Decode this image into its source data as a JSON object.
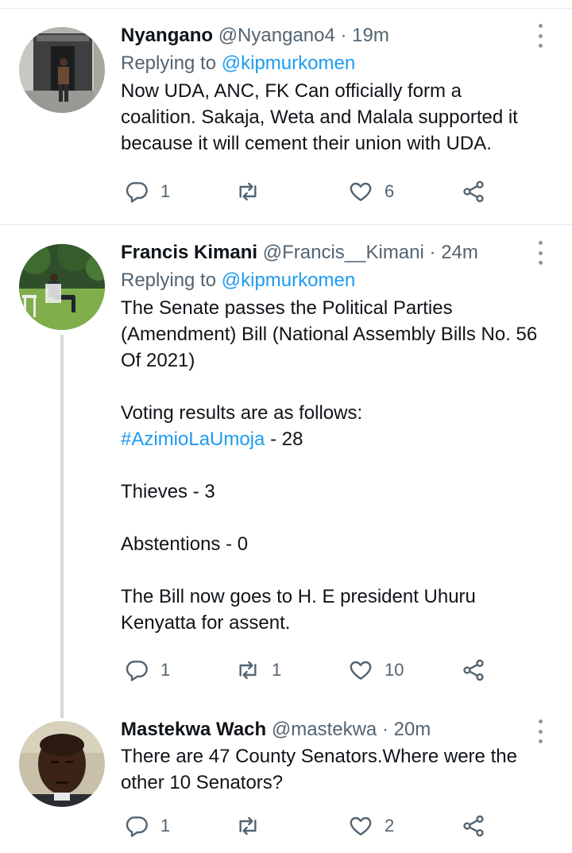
{
  "tweets": [
    {
      "name": "Nyangano",
      "handle": "@Nyangano4",
      "separator": "·",
      "time": "19m",
      "replying_prefix": "Replying to",
      "replying_to": "@kipmurkomen",
      "text": "Now UDA, ANC, FK Can officially form a coalition. Sakaja, Weta and Malala supported it because it will cement their union with UDA.",
      "replies": "1",
      "retweets": "",
      "likes": "6"
    },
    {
      "name": "Francis Kimani",
      "handle": "@Francis__Kimani",
      "separator": "·",
      "time": "24m",
      "replying_prefix": "Replying to",
      "replying_to": "@kipmurkomen",
      "text_1": "The Senate passes the Political Parties (Amendment) Bill (National Assembly Bills No. 56 Of 2021)\n\nVoting results are as follows:",
      "hashtag": "#AzimioLaUmoja",
      "hashtag_suffix": " - 28",
      "text_2": "\nThieves - 3\n\nAbstentions - 0\n\nThe Bill now goes to H. E president Uhuru Kenyatta for assent.",
      "replies": "1",
      "retweets": "1",
      "likes": "10"
    },
    {
      "name": "Mastekwa Wach",
      "handle": "@mastekwa",
      "separator": "·",
      "time": "20m",
      "text": "There are 47 County Senators.Where were the other 10 Senators?",
      "replies": "1",
      "retweets": "",
      "likes": "2"
    }
  ],
  "icons": {
    "reply": "reply-icon",
    "retweet": "retweet-icon",
    "like": "heart-icon",
    "share": "share-icon",
    "more": "more-icon"
  },
  "colors": {
    "link": "#1d9bf0",
    "secondary_text": "#536471",
    "icon": "#536471",
    "divider": "#e6e9ec"
  }
}
